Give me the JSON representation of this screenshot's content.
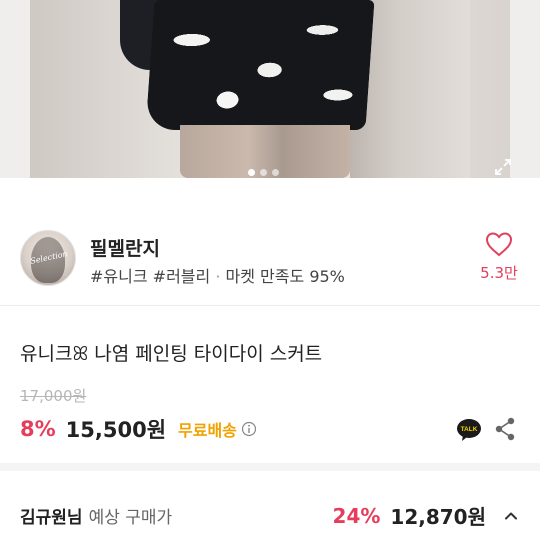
{
  "hero": {
    "image_alt": "tie-dye skirt photo",
    "carousel_total": 3,
    "carousel_active": 1
  },
  "seller": {
    "avatar_text": "Selection",
    "name": "필멜란지",
    "tag1": "#유니크",
    "tag2": "#러블리",
    "separator": "·",
    "satisfaction_label": "마켓 만족도",
    "satisfaction_value": "95%",
    "like_count": "5.3만"
  },
  "product": {
    "title": "유니크ꕤ 나염 페인팅 타이다이 스커트",
    "original_price": "17,000원",
    "discount": "8%",
    "price": "15,500원",
    "free_shipping": "무료배송"
  },
  "icons": {
    "heart": "heart-icon",
    "info": "info-icon",
    "talk": "kakao-talk-icon",
    "share": "share-icon",
    "expand": "expand-icon",
    "chevron": "chevron-up-icon",
    "talk_text": "TALK"
  },
  "expected": {
    "user_name": "김규원님",
    "label": "예상 구매가",
    "discount": "24%",
    "price": "12,870원"
  },
  "colors": {
    "accent_pink": "#e53e5c",
    "free_ship_orange": "#f0a300"
  }
}
